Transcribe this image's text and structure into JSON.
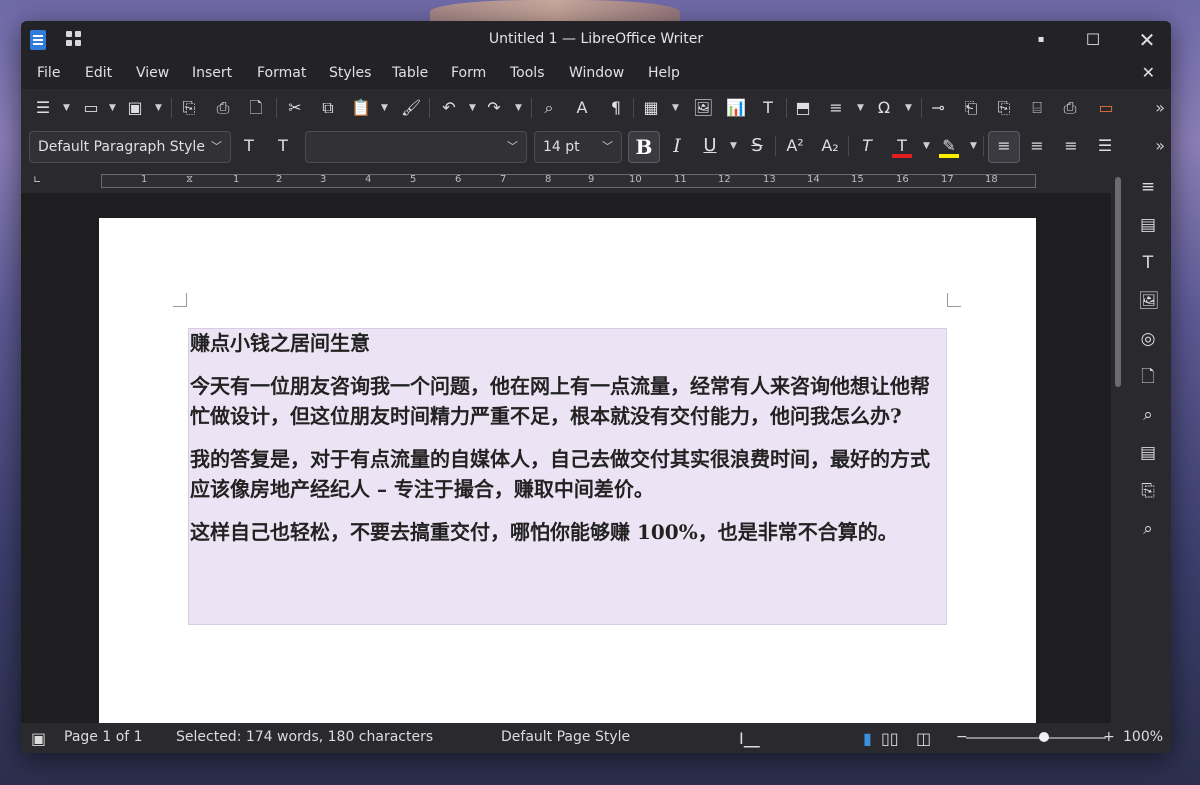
{
  "window": {
    "title": "Untitled 1 — LibreOffice Writer"
  },
  "menu": [
    "File",
    "Edit",
    "View",
    "Insert",
    "Format",
    "Styles",
    "Table",
    "Form",
    "Tools",
    "Window",
    "Help"
  ],
  "formatting": {
    "paragraph_style": "Default Paragraph Style",
    "font_name": "",
    "font_size": "14 pt"
  },
  "ruler": {
    "numbers": [
      "1",
      "1",
      "1",
      "2",
      "3",
      "4",
      "5",
      "6",
      "7",
      "8",
      "9",
      "10",
      "11",
      "12",
      "13",
      "14",
      "15",
      "16",
      "17",
      "18"
    ]
  },
  "document": {
    "paragraphs": [
      "赚点小钱之居间生意",
      "今天有一位朋友咨询我一个问题，他在网上有一点流量，经常有人来咨询他想让他帮忙做设计，但这位朋友时间精力严重不足，根本就没有交付能力，他问我怎么办?",
      "我的答复是，对于有点流量的自媒体人，自己去做交付其实很浪费时间，最好的方式应该像房地产经纪人 – 专注于撮合，赚取中间差价。",
      "这样自己也轻松，不要去搞重交付，哪怕你能够赚 100%，也是非常不合算的。"
    ]
  },
  "status": {
    "page": "Page 1 of 1",
    "selection": "Selected: 174 words, 180 characters",
    "page_style": "Default Page Style",
    "zoom": "100%",
    "zoom_level": 1.0
  },
  "colors": {
    "font_color": "#e02020",
    "highlight_color": "#ffee00",
    "selection_bg": "#ece4f4"
  }
}
